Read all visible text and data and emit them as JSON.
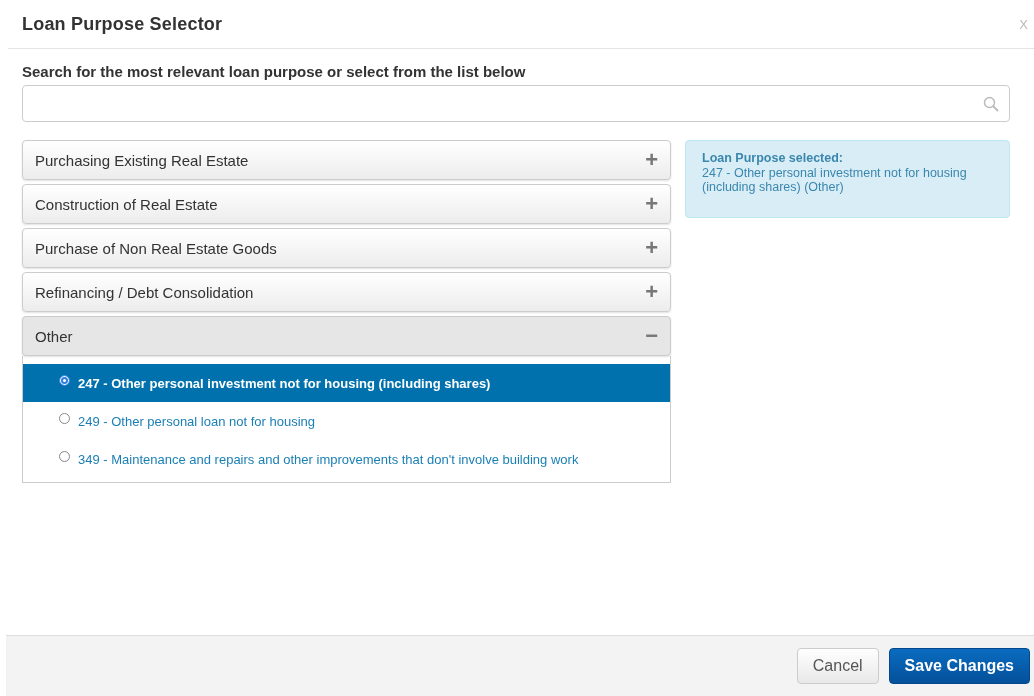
{
  "dialog": {
    "title": "Loan Purpose Selector",
    "close": "X"
  },
  "search": {
    "label": "Search for the most relevant loan purpose or select from the list below"
  },
  "categories": [
    {
      "label": "Purchasing Existing Real Estate",
      "expanded": false,
      "toggle": "+"
    },
    {
      "label": "Construction of Real Estate",
      "expanded": false,
      "toggle": "+"
    },
    {
      "label": "Purchase of Non Real Estate Goods",
      "expanded": false,
      "toggle": "+"
    },
    {
      "label": "Refinancing / Debt Consolidation",
      "expanded": false,
      "toggle": "+"
    },
    {
      "label": "Other",
      "expanded": true,
      "toggle": "−",
      "options": [
        {
          "label": "247 - Other personal investment not for housing (including shares)",
          "selected": true
        },
        {
          "label": "249 - Other personal loan not for housing",
          "selected": false
        },
        {
          "label": "349 - Maintenance and repairs and other improvements that don't involve building work",
          "selected": false
        }
      ]
    }
  ],
  "selection": {
    "heading": "Loan Purpose selected:",
    "value": "247 - Other personal investment not for housing (including shares) (Other)"
  },
  "buttons": [
    {
      "label": "Cancel",
      "kind": "secondary"
    },
    {
      "label": "Save Changes",
      "kind": "primary"
    }
  ]
}
